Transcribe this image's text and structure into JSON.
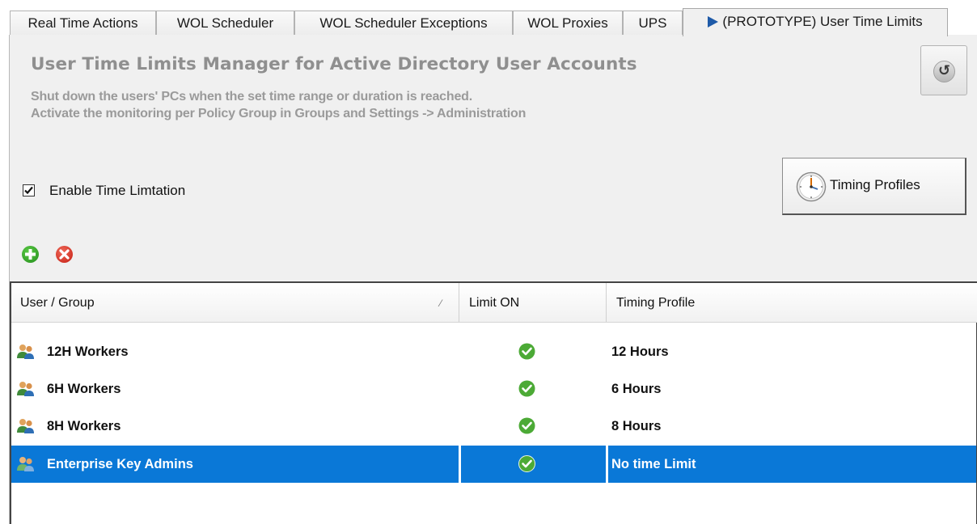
{
  "tabs": [
    {
      "label": "Real Time Actions",
      "active": false
    },
    {
      "label": "WOL Scheduler",
      "active": false
    },
    {
      "label": "WOL Scheduler Exceptions",
      "active": false
    },
    {
      "label": "WOL Proxies",
      "active": false
    },
    {
      "label": "UPS",
      "active": false
    },
    {
      "label": "(PROTOTYPE) User Time Limits",
      "active": true,
      "icon": "play-triangle-icon"
    }
  ],
  "header": {
    "title": "User Time Limits Manager for Active Directory User Accounts",
    "subtitle_line1": "Shut down the users' PCs when the set time range  or duration is reached.",
    "subtitle_line2": "Activate the monitoring per Policy Group in Groups and Settings -> Administration"
  },
  "refresh_button": {
    "icon": "refresh-icon"
  },
  "enable_checkbox": {
    "label": "Enable Time Limtation",
    "checked": true
  },
  "timing_profiles_button": {
    "label": "Timing Profiles",
    "icon": "clock-icon"
  },
  "actions": {
    "add_icon": "add-icon",
    "remove_icon": "remove-icon"
  },
  "grid": {
    "columns": {
      "user": "User / Group",
      "limit": "Limit ON",
      "profile": "Timing Profile"
    },
    "sort_glyph": "⁄",
    "rows": [
      {
        "name": "12H Workers",
        "limit_on": true,
        "profile": "12 Hours",
        "selected": false
      },
      {
        "name": "6H Workers",
        "limit_on": true,
        "profile": "6 Hours",
        "selected": false
      },
      {
        "name": "8H Workers",
        "limit_on": true,
        "profile": "8 Hours",
        "selected": false
      },
      {
        "name": "Enterprise Key Admins",
        "limit_on": true,
        "profile": "No time Limit",
        "selected": true
      }
    ]
  },
  "colors": {
    "selection": "#0a78d7",
    "heading": "#8f8f8f",
    "check_green": "#4caa36",
    "tab_arrow": "#1e5aa8"
  }
}
